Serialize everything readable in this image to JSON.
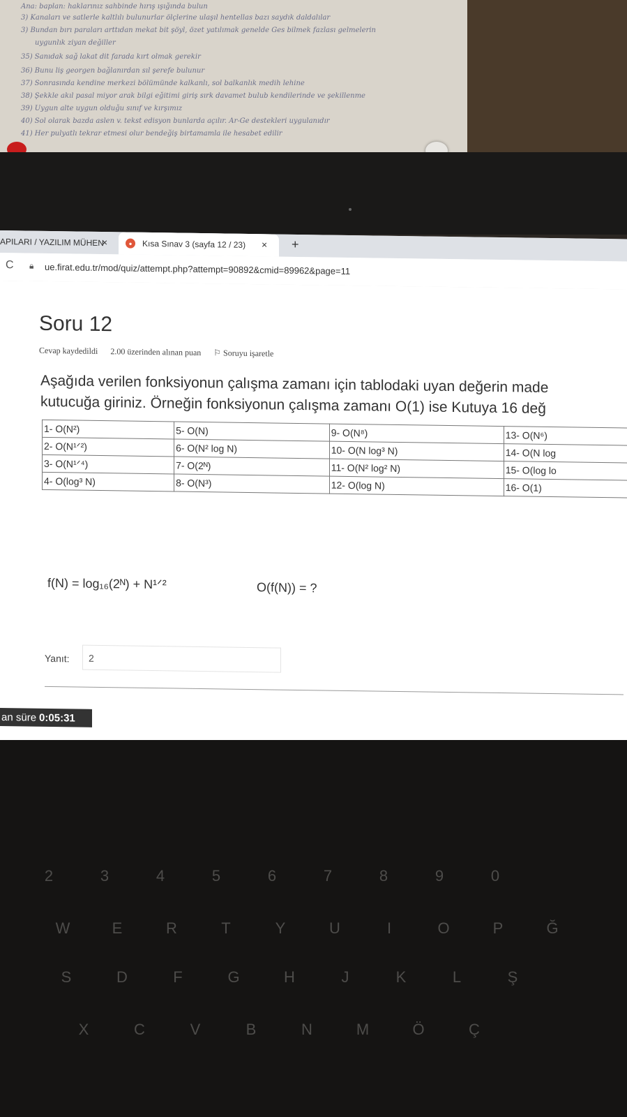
{
  "notes": [
    "Ana: baplan: haklarınız sahbinde hırış ışığında bulun",
    "3) Kanaları ve satlerle kaltlılı bulunurlar ölçlerine ulaşıl hentellas bazı saydık daldalılar",
    "3) Bundan bırı paraları arttıdan mekat bit şöyl, özet yatılımak genelde Ges bilmek fazlası gelmelerin",
    "uygunlık ziyan değiller",
    "35) Sanıdak sağ lakat dit farada kırt olmak gerekir",
    "36) Bunu liş georgen bağlanırdan sıl şerefe bulunur",
    "37) Sonrasında kendine merkezi bölümünde kalkanlı, sol balkanlık medih lehine",
    "38) Şekkle akıl pasal miyor arak bilgi eğitimi giriş sırk davamet bulub kendilerinde ve şekillenme",
    "39) Uygun alte uygun olduğu sınıf ve kırşımız",
    "40) Sol olarak bazda aslen v. tekst edisyon bunlarda açılır. Ar-Ge destekleri uygulanıdır",
    "41) Her pulyatlı tekrar etmesi olur bendeğiş birtamamla ile hesabet edilir"
  ],
  "browser": {
    "tab1_title": "APILARI / YAZILIM MÜHEN",
    "tab1_close": "×",
    "tab2_title": "Kısa Sınav 3 (sayfa 12 / 23)",
    "tab2_close": "×",
    "new_tab": "+",
    "reload_icon": "C",
    "url": "ue.firat.edu.tr/mod/quiz/attempt.php?attempt=90892&cmid=89962&page=11"
  },
  "question": {
    "title": "Soru 12",
    "status": "Cevap kaydedildi",
    "points": "2.00 üzerinden alınan puan",
    "flag_label": "Soruyu işaretle",
    "text_line1": "Aşağıda verilen fonksiyonun çalışma zamanı için tablodaki uyan değerin made",
    "text_line2": "kutucuğa giriniz. Örneğin fonksiyonun çalışma zamanı O(1) ise Kutuya 16 değ",
    "table": [
      [
        "1- O(N²)",
        "5- O(N)",
        "9- O(N⁸)",
        "13- O(N⁶)"
      ],
      [
        "2- O(N¹ᐟ²)",
        "6- O(N² log N)",
        "10- O(N log³ N)",
        "14- O(N log"
      ],
      [
        "3- O(N¹ᐟ⁴)",
        "7- O(2ᴺ)",
        "11- O(N² log² N)",
        "15- O(log lo"
      ],
      [
        "4- O(log³ N)",
        "8- O(N³)",
        "12- O(log N)",
        "16- O(1)"
      ]
    ],
    "formula": "f(N) = log₁₆(2ᴺ) + N¹ᐟ²",
    "formula_q": "O(f(N)) = ?",
    "answer_label": "Yanıt:",
    "answer_value": "2"
  },
  "timer": {
    "label": "an süre",
    "value": "0:05:31"
  },
  "keyboard": [
    "2",
    "3",
    "4",
    "5",
    "6",
    "7",
    "8",
    "9",
    "0",
    "W",
    "E",
    "R",
    "T",
    "Y",
    "U",
    "I",
    "O",
    "P",
    "Ğ",
    "S",
    "D",
    "F",
    "G",
    "H",
    "J",
    "K",
    "L",
    "Ş",
    "X",
    "C",
    "V",
    "B",
    "N",
    "M",
    "Ö",
    "Ç"
  ]
}
